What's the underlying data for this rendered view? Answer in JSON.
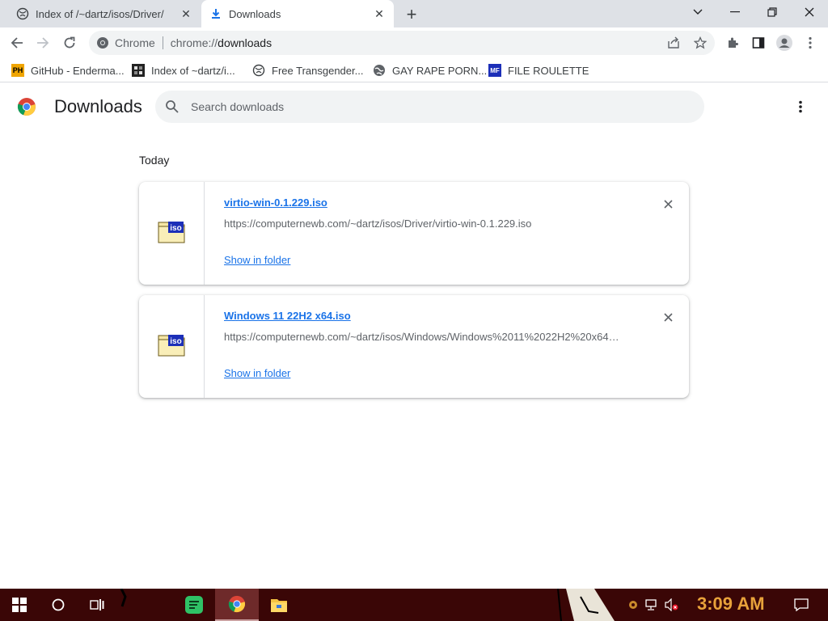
{
  "tabs": [
    {
      "label": "Index of /~dartz/isos/Driver/",
      "icon": "globe-icon",
      "active": false
    },
    {
      "label": "Downloads",
      "icon": "download-icon",
      "active": true
    }
  ],
  "toolbar": {
    "site_label": "Chrome",
    "url_scheme": "chrome://",
    "url_host": "downloads"
  },
  "bookmarks": [
    {
      "label": "GitHub - Enderma...",
      "icon": "ph-icon",
      "icon_text": "PH"
    },
    {
      "label": "Index of ~dartz/i...",
      "icon": "pixel-icon"
    },
    {
      "label": "Free Transgender...",
      "icon": "globe-icon"
    },
    {
      "label": "GAY RAPE PORN...",
      "icon": "globe-icon"
    },
    {
      "label": "FILE ROULETTE",
      "icon": "mf-icon",
      "icon_text": "MF"
    }
  ],
  "downloads": {
    "title": "Downloads",
    "search_placeholder": "Search downloads",
    "section_label": "Today",
    "items": [
      {
        "name": "virtio-win-0.1.229.iso",
        "url": "https://computernewb.com/~dartz/isos/Driver/virtio-win-0.1.229.iso",
        "action": "Show in folder",
        "icon": "iso-file-icon",
        "icon_text": "iso"
      },
      {
        "name": "Windows 11 22H2 x64.iso",
        "url": "https://computernewb.com/~dartz/isos/Windows/Windows%2011%2022H2%20x64…",
        "action": "Show in folder",
        "icon": "iso-file-icon",
        "icon_text": "iso"
      }
    ]
  },
  "taskbar": {
    "clock": "3:09 AM"
  },
  "colors": {
    "link": "#1a73e8",
    "tabstrip": "#dee1e6",
    "taskbar": "#3a0606",
    "clock": "#e8a23a"
  }
}
